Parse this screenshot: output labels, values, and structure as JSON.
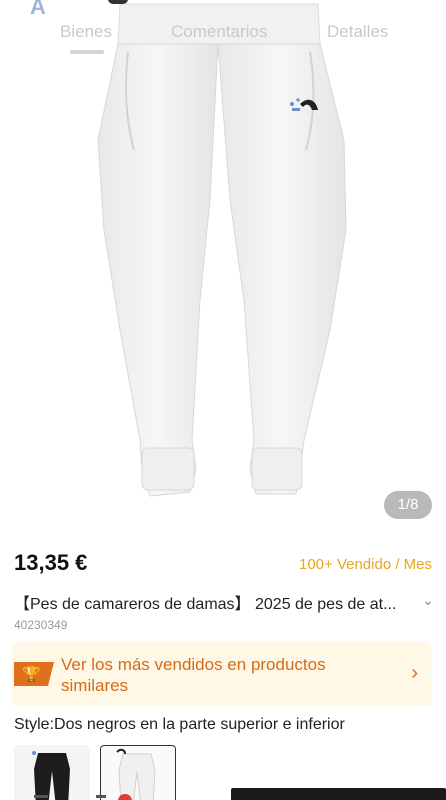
{
  "tabs": [
    "Bienes",
    "Comentarios",
    "Detalles"
  ],
  "image_counter": "1/8",
  "product": {
    "price": "13,35 €",
    "sold": "100+ Vendido / Mes",
    "title": "【Pes de camareros de damas】 2025  de pes de at...",
    "sku": "40230349"
  },
  "banner": {
    "text": "Ver los más vendidos en productos similares",
    "arrow": "›"
  },
  "style": {
    "label": "Style:Dos negros en la parte superior e inferior",
    "options": [
      "black",
      "white"
    ]
  },
  "colors": {
    "accent_orange": "#e0701d",
    "sold_yellow": "#e8a523",
    "banner_bg": "#fff8e6"
  },
  "icons": {
    "title_expand": "chevron-down-icon",
    "banner_icon": "trophy-icon"
  }
}
